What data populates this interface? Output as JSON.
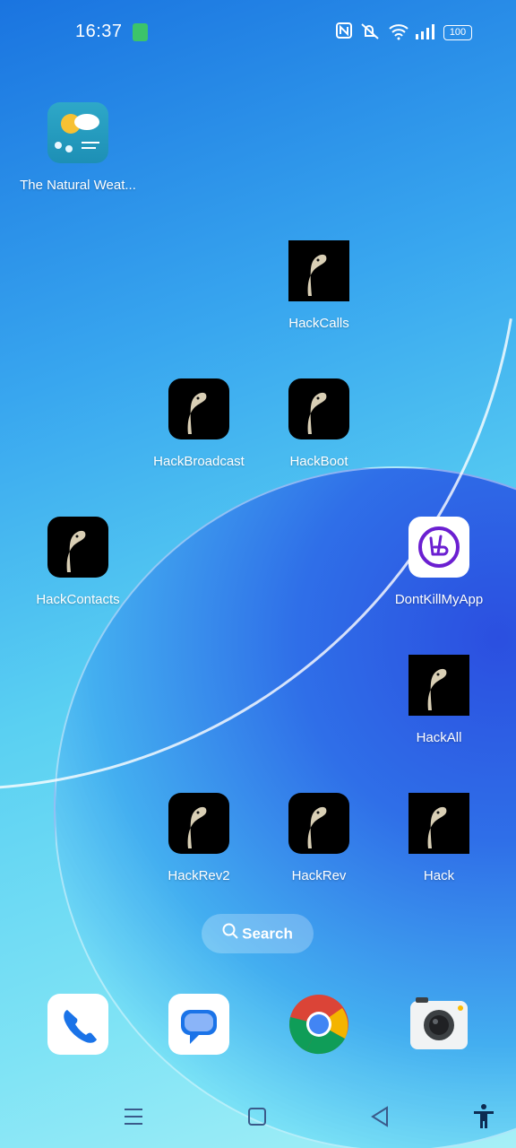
{
  "status": {
    "time": "16:37",
    "battery": "100"
  },
  "apps": [
    {
      "label": "The Natural Weat..."
    },
    {
      "label": "HackCalls"
    },
    {
      "label": "HackBroadcast"
    },
    {
      "label": "HackBoot"
    },
    {
      "label": "HackContacts"
    },
    {
      "label": "DontKillMyApp"
    },
    {
      "label": "HackAll"
    },
    {
      "label": "HackRev2"
    },
    {
      "label": "HackRev"
    },
    {
      "label": "Hack"
    }
  ],
  "search": {
    "label": "Search"
  },
  "colors": {
    "dontkill_purple": "#6b1fd1",
    "phone_blue": "#1a73e8",
    "battery_green": "#3cc46a"
  }
}
